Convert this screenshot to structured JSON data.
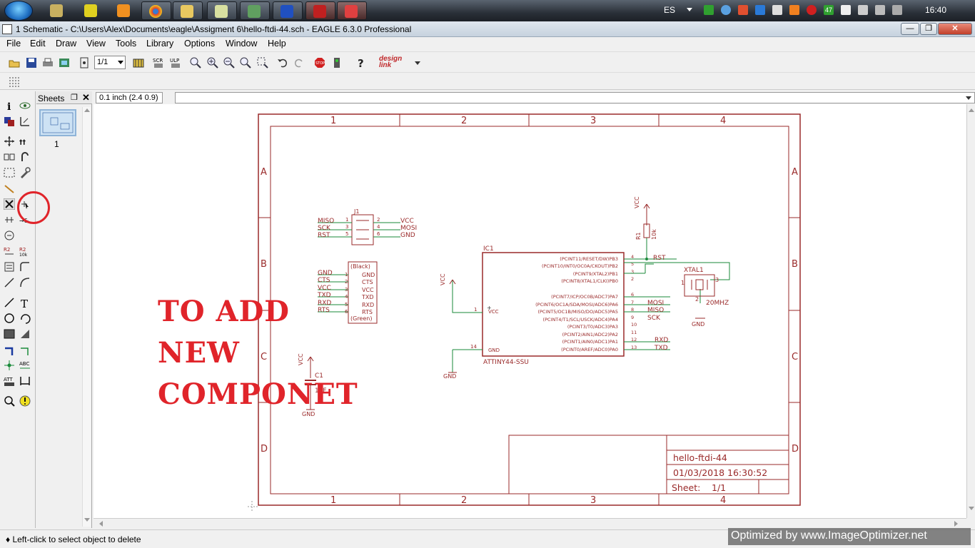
{
  "taskbar": {
    "lang": "ES",
    "time": "16:40",
    "badge_count": "47"
  },
  "window": {
    "title": "1 Schematic - C:\\Users\\Alex\\Documents\\eagle\\Assigment 6\\hello-ftdi-44.sch - EAGLE 6.3.0 Professional",
    "min": "—",
    "max": "❐",
    "close": "✕"
  },
  "menu": [
    "File",
    "Edit",
    "Draw",
    "View",
    "Tools",
    "Library",
    "Options",
    "Window",
    "Help"
  ],
  "toolbar": {
    "zoom_value": "1/1",
    "brand": "design link"
  },
  "sheets": {
    "title": "Sheets",
    "items": [
      "1"
    ]
  },
  "coord": "0.1 inch (2.4 0.9)",
  "annotation": [
    "TO ADD",
    "NEW",
    "COMPONET"
  ],
  "schematic": {
    "col_labels": [
      "1",
      "2",
      "3",
      "4"
    ],
    "row_labels": [
      "A",
      "B",
      "C",
      "D"
    ],
    "title_block": {
      "name": "hello-ftdi-44",
      "date": "01/03/2018 16:30:52",
      "sheet_label": "Sheet:",
      "sheet_value": "1/1"
    },
    "header_j1": {
      "ref": "J1",
      "left": [
        "MISO",
        "SCK",
        "RST"
      ],
      "left_pins": [
        "1",
        "3",
        "5"
      ],
      "right_pins": [
        "2",
        "4",
        "6"
      ],
      "right": [
        "VCC",
        "MOSI",
        "GND"
      ]
    },
    "ftdi": {
      "top": "(Black)",
      "bottom": "(Green)",
      "pins": [
        "GND",
        "CTS",
        "VCC",
        "TXD",
        "RXD",
        "RTS"
      ],
      "nets": [
        "GND",
        "CTS",
        "VCC",
        "TXD",
        "RXD",
        "RTS"
      ],
      "nums": [
        "1",
        "2",
        "3",
        "4",
        "5",
        "6"
      ]
    },
    "ic1": {
      "ref": "IC1",
      "part": "ATTINY44-SSU",
      "right_pins": [
        "(PCINT11/RESET/DW)PB3",
        "(PCINT10/INT0/OC0A/CKOUT)PB2",
        "(PCINT9/XTAL2)PB1",
        "(PCINT8/XTAL1/CLKI)PB0",
        "(PCINT7/ICP/OC0B/ADC7)PA7",
        "(PCINT6/OC1A/SDA/MOSI/ADC6)PA6",
        "(PCINT5/OC1B/MISO/DO/ADC5)PA5",
        "(PCINT4/T1/SCL/USCK/ADC4)PA4",
        "(PCINT3/T0/ADC3)PA3",
        "(PCINT2/AIN1/ADC2)PA2",
        "(PCINT1/AIN0/ADC1)PA1",
        "(PCINT0/AREF/ADC0)PA0"
      ],
      "right_nums": [
        "4",
        "5",
        "3",
        "2",
        "6",
        "7",
        "8",
        "9",
        "10",
        "11",
        "12",
        "13"
      ],
      "vcc": "VCC",
      "gnd": "GND",
      "vcc_num": "1",
      "gnd_num": "14"
    },
    "nets": {
      "rst": "RST",
      "mosi": "MOSI",
      "miso": "MISO",
      "sck": "SCK",
      "rxd": "RXD",
      "txd": "TXD"
    },
    "r1": {
      "ref": "R1",
      "val": "10k",
      "supply": "VCC"
    },
    "xtal": {
      "ref": "XTAL1",
      "val": "20MHZ",
      "gnd": "GND",
      "p1": "1",
      "p2": "2",
      "p3": "3"
    },
    "c1": {
      "ref": "C1",
      "val": "1uF",
      "supply": "VCC",
      "gnd": "GND"
    },
    "supplies": {
      "vcc": "VCC",
      "gnd": "GND"
    }
  },
  "status": "♦ Left-click to select object to delete",
  "watermark": "Optimized by www.ImageOptimizer.net"
}
